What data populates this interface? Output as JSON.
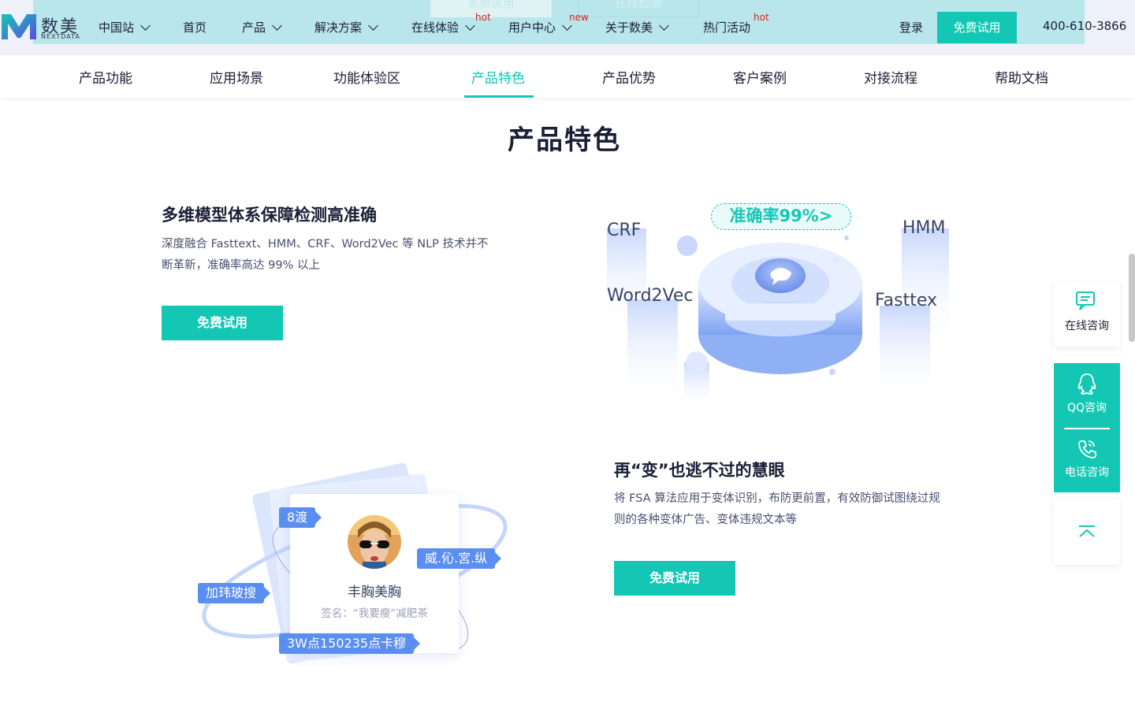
{
  "header": {
    "ghost_buttons": [
      "免费试用",
      "在线检测"
    ],
    "logo": {
      "name": "数美",
      "sub": "NEXTDATA"
    },
    "nav": [
      {
        "label": "中国站",
        "dropdown": true
      },
      {
        "label": "首页",
        "dropdown": false
      },
      {
        "label": "产品",
        "dropdown": true
      },
      {
        "label": "解决方案",
        "dropdown": true
      },
      {
        "label": "在线体验",
        "dropdown": true,
        "tag": "hot"
      },
      {
        "label": "用户中心",
        "dropdown": true,
        "tag": "new"
      },
      {
        "label": "关于数美",
        "dropdown": true
      },
      {
        "label": "热门活动",
        "dropdown": false,
        "tag": "hot"
      }
    ],
    "login": "登录",
    "trial": "免费试用",
    "phone": "400-610-3866"
  },
  "subnav": {
    "items": [
      "产品功能",
      "应用场景",
      "功能体验区",
      "产品特色",
      "产品优势",
      "客户案例",
      "对接流程",
      "帮助文档"
    ],
    "active_index": 3
  },
  "section": {
    "title": "产品特色",
    "features": [
      {
        "title": "多维模型体系保障检测高准确",
        "desc_line1": "深度融合 Fasttext、HMM、CRF、Word2Vec 等 NLP 技术并不",
        "desc_line2": "断革新，准确率高达 99% 以上",
        "button": "免费试用"
      },
      {
        "title": "再“变”也逃不过的慧眼",
        "desc_line1": "将 FSA 算法应用于变体识别，布防更前置，有效防御试图绕过规",
        "desc_line2": "则的各种变体广告、变体违规文本等",
        "button": "免费试用"
      }
    ]
  },
  "illustration1": {
    "accuracy": "准确率99%>",
    "labels": [
      "CRF",
      "HMM",
      "Word2Vec",
      "Fasttex"
    ]
  },
  "illustration2": {
    "chips": [
      "8渡",
      "威.伈.宮.纵",
      "加玮玻搜",
      "3W点150235点卡穆"
    ],
    "name": "丰胸美胸",
    "signature": "签名：“我要瘦”减肥茶"
  },
  "float_panel": {
    "online": "在线咨询",
    "qq": "QQ咨询",
    "phone": "电话咨询"
  },
  "colors": {
    "accent": "#14c7b4",
    "chip": "#5a8ef0",
    "hot": "#e02020"
  }
}
